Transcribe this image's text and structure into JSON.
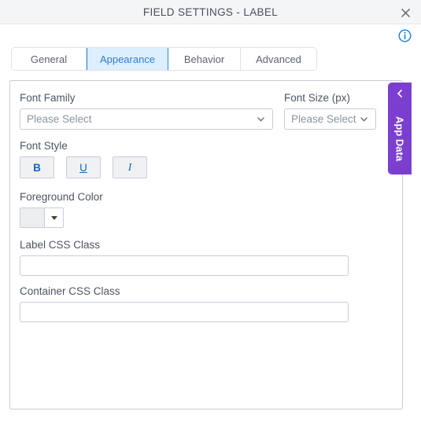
{
  "window": {
    "title": "FIELD SETTINGS - LABEL",
    "close_icon": "close-icon",
    "info_icon": "info-icon"
  },
  "tabs": [
    {
      "label": "General",
      "active": false
    },
    {
      "label": "Appearance",
      "active": true
    },
    {
      "label": "Behavior",
      "active": false
    },
    {
      "label": "Advanced",
      "active": false
    }
  ],
  "form": {
    "font_family": {
      "label": "Font Family",
      "value": "Please Select",
      "chevron_icon": "chevron-down-icon"
    },
    "font_size": {
      "label": "Font Size (px)",
      "value": "Please Select",
      "chevron_icon": "chevron-down-icon"
    },
    "font_style": {
      "label": "Font Style",
      "buttons": [
        {
          "label": "B",
          "name": "bold-button"
        },
        {
          "label": "U",
          "name": "underline-button"
        },
        {
          "label": "I",
          "name": "italic-button"
        }
      ]
    },
    "foreground_color": {
      "label": "Foreground Color",
      "swatch_color": "#eceef0",
      "caret_icon": "caret-down-icon"
    },
    "label_css_class": {
      "label": "Label CSS Class",
      "value": "",
      "placeholder": ""
    },
    "container_css_class": {
      "label": "Container CSS Class",
      "value": "",
      "placeholder": ""
    }
  },
  "app_data_panel": {
    "label": "App Data",
    "collapse_icon": "chevron-left-icon",
    "color": "#7b3fd0"
  },
  "colors": {
    "titlebar_bg": "#f4f5f7",
    "active_tab_bg": "#ddeeff",
    "active_tab_border": "#2f86d6",
    "accent_blue": "#1565c0",
    "border": "#c9ccd6"
  }
}
